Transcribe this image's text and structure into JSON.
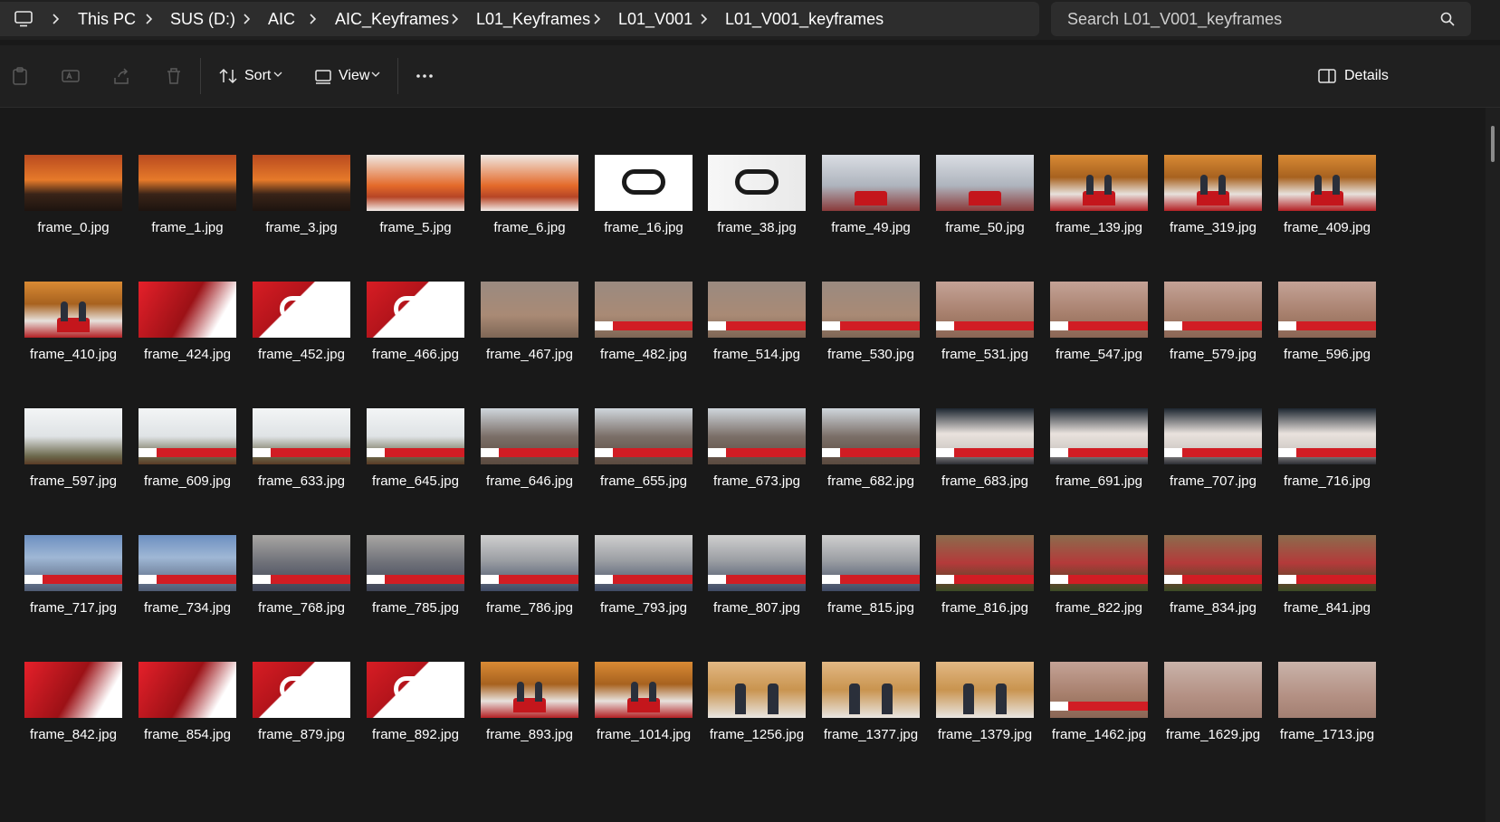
{
  "breadcrumb": {
    "items": [
      "This PC",
      "SUS (D:)",
      "AIC",
      "AIC_Keyframes",
      "L01_Keyframes",
      "L01_V001",
      "L01_V001_keyframes"
    ]
  },
  "search": {
    "placeholder": "Search L01_V001_keyframes"
  },
  "toolbar": {
    "sort_label": "Sort",
    "view_label": "View",
    "details_label": "Details"
  },
  "colors": {
    "accent": "#4cc2ff",
    "bg": "#191919",
    "bar": "#2d2d2d",
    "brand_red": "#d11d24"
  },
  "files": [
    {
      "name": "frame_0.jpg",
      "style": "sunset"
    },
    {
      "name": "frame_1.jpg",
      "style": "sunset"
    },
    {
      "name": "frame_3.jpg",
      "style": "sunset"
    },
    {
      "name": "frame_5.jpg",
      "style": "sunset2"
    },
    {
      "name": "frame_6.jpg",
      "style": "sunset2"
    },
    {
      "name": "frame_16.jpg",
      "style": "logo"
    },
    {
      "name": "frame_38.jpg",
      "style": "logo2"
    },
    {
      "name": "frame_49.jpg",
      "style": "studio"
    },
    {
      "name": "frame_50.jpg",
      "style": "studio"
    },
    {
      "name": "frame_139.jpg",
      "style": "anchor"
    },
    {
      "name": "frame_319.jpg",
      "style": "anchor"
    },
    {
      "name": "frame_409.jpg",
      "style": "anchor"
    },
    {
      "name": "frame_410.jpg",
      "style": "anchor"
    },
    {
      "name": "frame_424.jpg",
      "style": "red"
    },
    {
      "name": "frame_452.jpg",
      "style": "redlogo"
    },
    {
      "name": "frame_466.jpg",
      "style": "redlogo"
    },
    {
      "name": "frame_467.jpg",
      "style": "flood"
    },
    {
      "name": "frame_482.jpg",
      "style": "flood"
    },
    {
      "name": "frame_514.jpg",
      "style": "flood"
    },
    {
      "name": "frame_530.jpg",
      "style": "flood"
    },
    {
      "name": "frame_531.jpg",
      "style": "flood2"
    },
    {
      "name": "frame_547.jpg",
      "style": "flood2"
    },
    {
      "name": "frame_579.jpg",
      "style": "flood2"
    },
    {
      "name": "frame_596.jpg",
      "style": "flood2"
    },
    {
      "name": "frame_597.jpg",
      "style": "river"
    },
    {
      "name": "frame_609.jpg",
      "style": "river"
    },
    {
      "name": "frame_633.jpg",
      "style": "river"
    },
    {
      "name": "frame_645.jpg",
      "style": "river"
    },
    {
      "name": "frame_646.jpg",
      "style": "house"
    },
    {
      "name": "frame_655.jpg",
      "style": "house"
    },
    {
      "name": "frame_673.jpg",
      "style": "house"
    },
    {
      "name": "frame_682.jpg",
      "style": "house"
    },
    {
      "name": "frame_683.jpg",
      "style": "sand"
    },
    {
      "name": "frame_691.jpg",
      "style": "sand"
    },
    {
      "name": "frame_707.jpg",
      "style": "sand"
    },
    {
      "name": "frame_716.jpg",
      "style": "sand"
    },
    {
      "name": "frame_717.jpg",
      "style": "build"
    },
    {
      "name": "frame_734.jpg",
      "style": "build"
    },
    {
      "name": "frame_768.jpg",
      "style": "build2"
    },
    {
      "name": "frame_785.jpg",
      "style": "build2"
    },
    {
      "name": "frame_786.jpg",
      "style": "gate"
    },
    {
      "name": "frame_793.jpg",
      "style": "gate"
    },
    {
      "name": "frame_807.jpg",
      "style": "gate"
    },
    {
      "name": "frame_815.jpg",
      "style": "gate"
    },
    {
      "name": "frame_816.jpg",
      "style": "rescue"
    },
    {
      "name": "frame_822.jpg",
      "style": "rescue"
    },
    {
      "name": "frame_834.jpg",
      "style": "rescue"
    },
    {
      "name": "frame_841.jpg",
      "style": "rescue"
    },
    {
      "name": "frame_842.jpg",
      "style": "red"
    },
    {
      "name": "frame_854.jpg",
      "style": "red"
    },
    {
      "name": "frame_879.jpg",
      "style": "redlogo"
    },
    {
      "name": "frame_892.jpg",
      "style": "redlogo"
    },
    {
      "name": "frame_893.jpg",
      "style": "anchor"
    },
    {
      "name": "frame_1014.jpg",
      "style": "anchor"
    },
    {
      "name": "frame_1256.jpg",
      "style": "anchor2"
    },
    {
      "name": "frame_1377.jpg",
      "style": "anchor2"
    },
    {
      "name": "frame_1379.jpg",
      "style": "anchor2"
    },
    {
      "name": "frame_1462.jpg",
      "style": "flood2"
    },
    {
      "name": "frame_1629.jpg",
      "style": "pale"
    },
    {
      "name": "frame_1713.jpg",
      "style": "pale"
    }
  ]
}
